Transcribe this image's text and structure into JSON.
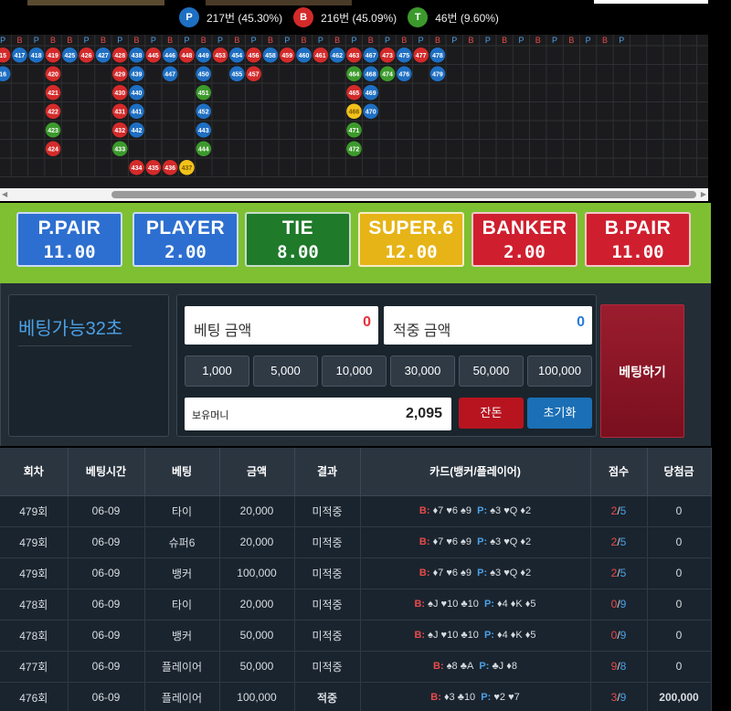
{
  "stats": {
    "player": {
      "letter": "P",
      "text": "217번 (45.30%)",
      "color": "#1e6fc3"
    },
    "banker": {
      "letter": "B",
      "text": "216번 (45.09%)",
      "color": "#d42a2a"
    },
    "tie": {
      "letter": "T",
      "text": "46번 (9.60%)",
      "color": "#3c9a2c"
    }
  },
  "roadmap": {
    "header_pattern": [
      "P",
      "B",
      "P",
      "B",
      "B",
      "P",
      "B",
      "P",
      "B",
      "P",
      "B",
      "P",
      "B",
      "P",
      "B",
      "P",
      "B",
      "P",
      "B",
      "P",
      "B",
      "P",
      "B",
      "P",
      "B",
      "P",
      "B",
      "P",
      "B",
      "P",
      "B",
      "P",
      "B",
      "P",
      "B",
      "P",
      "B",
      "P"
    ],
    "columns": [
      [
        {
          "n": "15",
          "c": "red"
        },
        {
          "n": "16",
          "c": "blue"
        }
      ],
      [
        {
          "n": "417",
          "c": "blue"
        }
      ],
      [
        {
          "n": "418",
          "c": "blue"
        }
      ],
      [
        {
          "n": "419",
          "c": "red"
        },
        {
          "n": "420",
          "c": "red"
        },
        {
          "n": "421",
          "c": "red"
        },
        {
          "n": "422",
          "c": "red"
        },
        {
          "n": "423",
          "c": "green"
        },
        {
          "n": "424",
          "c": "red"
        }
      ],
      [
        {
          "n": "425",
          "c": "blue"
        }
      ],
      [
        {
          "n": "426",
          "c": "red"
        }
      ],
      [
        {
          "n": "427",
          "c": "blue"
        }
      ],
      [
        {
          "n": "428",
          "c": "red"
        },
        {
          "n": "429",
          "c": "red"
        },
        {
          "n": "430",
          "c": "red"
        },
        {
          "n": "431",
          "c": "red"
        },
        {
          "n": "432",
          "c": "red"
        },
        {
          "n": "433",
          "c": "green"
        }
      ],
      [
        {
          "n": "438",
          "c": "blue"
        },
        {
          "n": "439",
          "c": "blue"
        },
        {
          "n": "440",
          "c": "blue"
        },
        {
          "n": "441",
          "c": "blue"
        },
        {
          "n": "442",
          "c": "blue"
        }
      ],
      [
        {
          "n": "445",
          "c": "red"
        }
      ],
      [
        {
          "n": "446",
          "c": "blue"
        },
        {
          "n": "447",
          "c": "blue"
        }
      ],
      [
        {
          "n": "448",
          "c": "red"
        }
      ],
      [
        {
          "n": "449",
          "c": "blue"
        },
        {
          "n": "450",
          "c": "blue"
        },
        {
          "n": "451",
          "c": "green"
        },
        {
          "n": "452",
          "c": "blue"
        },
        {
          "n": "443",
          "c": "blue"
        }
      ],
      [
        {
          "n": "453",
          "c": "red"
        }
      ],
      [
        {
          "n": "454",
          "c": "blue"
        },
        {
          "n": "455",
          "c": "blue"
        }
      ],
      [
        {
          "n": "456",
          "c": "red"
        },
        {
          "n": "457",
          "c": "red"
        }
      ],
      [
        {
          "n": "458",
          "c": "blue"
        }
      ],
      [
        {
          "n": "459",
          "c": "red"
        }
      ],
      [
        {
          "n": "460",
          "c": "blue"
        }
      ],
      [
        {
          "n": "461",
          "c": "red"
        }
      ],
      [
        {
          "n": "462",
          "c": "blue"
        }
      ],
      [
        {
          "n": "463",
          "c": "red"
        },
        {
          "n": "464",
          "c": "green"
        },
        {
          "n": "465",
          "c": "red"
        },
        {
          "n": "466",
          "c": "yellow"
        },
        {
          "n": "471",
          "c": "green"
        },
        {
          "n": "472",
          "c": "green"
        }
      ],
      [
        {
          "n": "467",
          "c": "blue"
        },
        {
          "n": "468",
          "c": "blue"
        },
        {
          "n": "469",
          "c": "blue"
        },
        {
          "n": "470",
          "c": "blue"
        }
      ],
      [
        {
          "n": "473",
          "c": "red"
        },
        {
          "n": "474",
          "c": "green"
        }
      ],
      [
        {
          "n": "475",
          "c": "blue"
        },
        {
          "n": "476",
          "c": "blue"
        }
      ],
      [
        {
          "n": "477",
          "c": "red"
        }
      ],
      [
        {
          "n": "478",
          "c": "blue"
        },
        {
          "n": "479",
          "c": "blue"
        }
      ]
    ],
    "extras": [
      {
        "col": 12,
        "row": 5,
        "n": "444",
        "c": "green"
      },
      {
        "col": 8,
        "row": 6,
        "n": "434",
        "c": "red"
      },
      {
        "col": 9,
        "row": 6,
        "n": "435",
        "c": "red"
      },
      {
        "col": 10,
        "row": 6,
        "n": "436",
        "c": "red"
      },
      {
        "col": 11,
        "row": 6,
        "n": "437",
        "c": "yellow"
      }
    ]
  },
  "bet_options": [
    {
      "name": "P.PAIR",
      "odds": "11.00",
      "bg": "#2d6fd0"
    },
    {
      "name": "PLAYER",
      "odds": "2.00",
      "bg": "#2d6fd0"
    },
    {
      "name": "TIE",
      "odds": "8.00",
      "bg": "#1f7a2a"
    },
    {
      "name": "SUPER.6",
      "odds": "12.00",
      "bg": "#e6b417"
    },
    {
      "name": "BANKER",
      "odds": "2.00",
      "bg": "#cf1f2f"
    },
    {
      "name": "B.PAIR",
      "odds": "11.00",
      "bg": "#cf1f2f"
    }
  ],
  "panel": {
    "timer": "베팅가능32초",
    "bet_amount_label": "베팅 금액",
    "bet_amount_value": "0",
    "win_amount_label": "적중 금액",
    "win_amount_value": "0",
    "chips": [
      "1,000",
      "5,000",
      "10,000",
      "30,000",
      "50,000",
      "100,000"
    ],
    "balance_label": "보유머니",
    "balance_value": "2,095",
    "change_button": "잔돈",
    "reset_button": "초기화",
    "place_bet_button": "베팅하기"
  },
  "history": {
    "headers": [
      "회차",
      "베팅시간",
      "베팅",
      "금액",
      "결과",
      "카드(뱅커/플레이어)",
      "점수",
      "당첨금"
    ],
    "rows": [
      {
        "round": "479회",
        "time": "06-09",
        "bet": "타이",
        "amount": "20,000",
        "result": "미적중",
        "banker_cards": "♦7 ♥6 ♠9",
        "player_cards": "♠3 ♥Q ♦2",
        "score_b": "2",
        "score_p": "5",
        "payout": "0"
      },
      {
        "round": "479회",
        "time": "06-09",
        "bet": "슈퍼6",
        "amount": "20,000",
        "result": "미적중",
        "banker_cards": "♦7 ♥6 ♠9",
        "player_cards": "♠3 ♥Q ♦2",
        "score_b": "2",
        "score_p": "5",
        "payout": "0"
      },
      {
        "round": "479회",
        "time": "06-09",
        "bet": "뱅커",
        "amount": "100,000",
        "result": "미적중",
        "banker_cards": "♦7 ♥6 ♠9",
        "player_cards": "♠3 ♥Q ♦2",
        "score_b": "2",
        "score_p": "5",
        "payout": "0"
      },
      {
        "round": "478회",
        "time": "06-09",
        "bet": "타이",
        "amount": "20,000",
        "result": "미적중",
        "banker_cards": "♠J ♥10 ♣10",
        "player_cards": "♦4 ♦K ♦5",
        "score_b": "0",
        "score_p": "9",
        "payout": "0"
      },
      {
        "round": "478회",
        "time": "06-09",
        "bet": "뱅커",
        "amount": "50,000",
        "result": "미적중",
        "banker_cards": "♠J ♥10 ♣10",
        "player_cards": "♦4 ♦K ♦5",
        "score_b": "0",
        "score_p": "9",
        "payout": "0"
      },
      {
        "round": "477회",
        "time": "06-09",
        "bet": "플레이어",
        "amount": "50,000",
        "result": "미적중",
        "banker_cards": "♠8 ♣A",
        "player_cards": "♣J ♦8",
        "score_b": "9",
        "score_p": "8",
        "payout": "0"
      },
      {
        "round": "476회",
        "time": "06-09",
        "bet": "플레이어",
        "amount": "100,000",
        "result": "적중",
        "banker_cards": "♦3 ♣10",
        "player_cards": "♥2 ♥7",
        "score_b": "3",
        "score_p": "9",
        "payout": "200,000"
      }
    ]
  }
}
